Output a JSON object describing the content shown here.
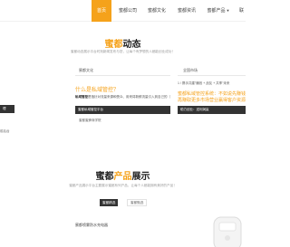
{
  "nav": {
    "items": [
      {
        "label": "首页",
        "active": true
      },
      {
        "label": "蜜都公司",
        "active": false
      },
      {
        "label": "蜜都文化",
        "active": false
      },
      {
        "label": "蜜都资讯",
        "active": false
      },
      {
        "label": "蜜都产品",
        "active": false,
        "has_dropdown": true
      },
      {
        "label": "联",
        "active": false
      }
    ]
  },
  "news": {
    "title_prefix": "蜜都",
    "title_suffix": "动态",
    "subtitle": "蜜都动态展示平台时刻新闻发布与您，让每个有梦想的人都能创业成功！",
    "left_col": {
      "head": "蜜都文化",
      "article_title": "什么是私域管控？",
      "excerpt_label": "私域管控",
      "excerpt_text": "是指针对流量来源和受众、用来将新鲜流量引入到自己的（",
      "dark_row": "蜜都私域管控平台",
      "plain_row": "蜜都蜜蜂商学院"
    },
    "far_left": {
      "rows": [
        "理",
        "前后台"
      ]
    },
    "right_col": {
      "head": "全国市场",
      "title_line1": "蜜都私域管控系统：不如说先赚钱",
      "title_line2": "再赚取更多市场营业赢得客户资源",
      "dark_row": "助力创业：送利润赢",
      "small_row": "1 / 携手共建\"赚钱 + 战友 + 共享\"未来"
    }
  },
  "products": {
    "title_prefix": "蜜都",
    "title_highlight": "产品",
    "title_suffix": "展示",
    "subtitle": "蜜都产品展示平台主要展示蜜都系列产品，让每个人都能拥有美好的产品！",
    "tabs": [
      "蜜都精选",
      "蜜都甄选"
    ],
    "featured_name": "蜜都喷雾防水充电器"
  },
  "colors": {
    "accent": "#f5a21b",
    "dark": "#333333"
  }
}
